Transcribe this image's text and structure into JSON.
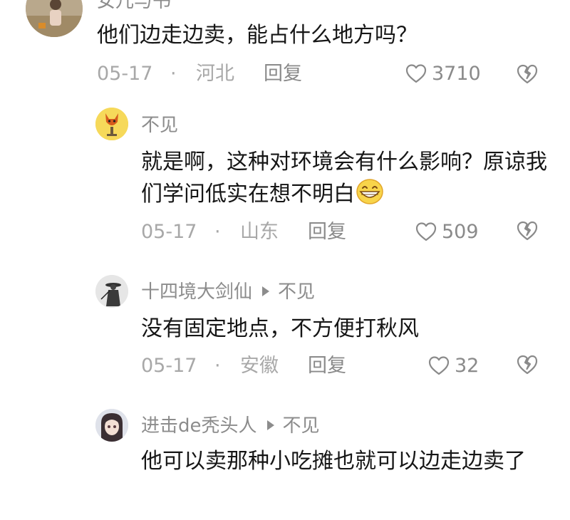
{
  "colors": {
    "text": "#161616",
    "secondary": "#8c8c8c",
    "meta": "#a8a8a8",
    "background": "#ffffff"
  },
  "comments": [
    {
      "author": "女儿与书",
      "text": "他们边走边卖，能占什么地方吗？",
      "date": "05-17",
      "separator": "·",
      "region": "河北",
      "reply_label": "回复",
      "likes": "3710",
      "avatar_icon": "child-photo-avatar"
    },
    {
      "author": "不见",
      "text": "就是啊，这种对环境会有什么影响？原谅我们学问低实在想不明白",
      "emoji": "grinning-face-emoji",
      "date": "05-17",
      "separator": "·",
      "region": "山东",
      "reply_label": "回复",
      "likes": "509",
      "avatar_icon": "fox-avatar"
    },
    {
      "author": "十四境大剑仙",
      "reply_to": "不见",
      "text": "没有固定地点，不方便打秋风",
      "date": "05-17",
      "separator": "·",
      "region": "安徽",
      "reply_label": "回复",
      "likes": "32",
      "avatar_icon": "swordsman-avatar"
    },
    {
      "author": "进击de秃头人",
      "reply_to": "不见",
      "text": "他可以卖那种小吃摊也就可以边走边卖了",
      "avatar_icon": "anime-girl-avatar"
    }
  ]
}
